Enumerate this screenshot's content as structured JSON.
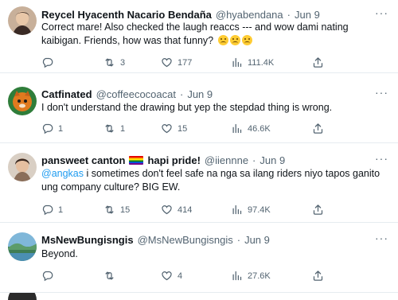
{
  "tweets": [
    {
      "name": "Reycel Hyacenth Nacario Bendaña",
      "handle": "@hyabendana",
      "dot": "·",
      "time": "Jun 9",
      "text": "Correct mare! Also checked the laugh reaccs --- and wow dami nating kaibigan. Friends, how was that funny?",
      "emoji_name": "frowning-face",
      "replies": "",
      "retweets": "3",
      "likes": "177",
      "views": "111.4K"
    },
    {
      "name": "Catfinated",
      "handle": "@coffeecocoacat",
      "dot": "·",
      "time": "Jun 9",
      "text": "I don't understand the drawing but yep the stepdad thing is wrong.",
      "replies": "1",
      "retweets": "1",
      "likes": "15",
      "views": "46.6K"
    },
    {
      "name": "pansweet canton",
      "flag_name": "rainbow-flag",
      "name_suffix": "hapi pride!",
      "handle": "@iiennne",
      "dot": "·",
      "time": "Jun 9",
      "mention": "@angkas",
      "text": " i sometimes don't feel safe na nga sa ilang riders niyo tapos ganito ung company culture? BIG EW.",
      "replies": "1",
      "retweets": "15",
      "likes": "414",
      "views": "97.4K"
    },
    {
      "name": "MsNewBungisngis",
      "handle": "@MsNewBungisngis",
      "dot": "·",
      "time": "Jun 9",
      "text": "Beyond.",
      "replies": "",
      "retweets": "",
      "likes": "4",
      "views": "27.6K"
    }
  ],
  "icons": {
    "more": "more-icon",
    "reply": "reply-icon",
    "retweet": "retweet-icon",
    "like": "heart-icon",
    "views": "views-icon",
    "share": "share-icon"
  },
  "more_glyph": "···",
  "colors": {
    "text": "#0f1419",
    "secondary": "#536471",
    "link": "#1d9bf0",
    "divider": "#e6ecf0"
  }
}
